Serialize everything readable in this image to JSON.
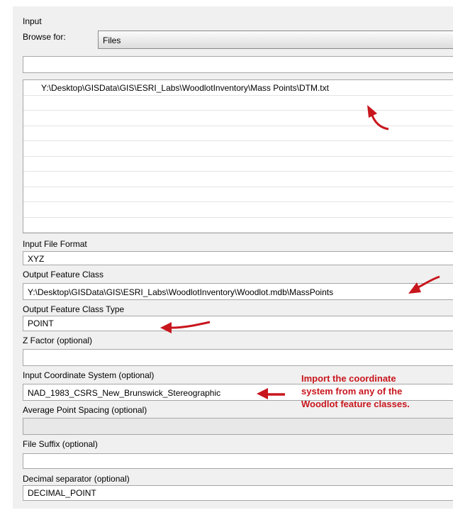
{
  "input_section": {
    "heading": "Input",
    "browse_for_label": "Browse for:",
    "browse_for_value": "Files",
    "path_value": ""
  },
  "file_list": {
    "rows": [
      "Y:\\Desktop\\GISData\\GIS\\ESRI_Labs\\WoodlotInventory\\Mass Points\\DTM.txt",
      "",
      "",
      "",
      "",
      "",
      "",
      "",
      "",
      ""
    ]
  },
  "params": {
    "input_file_format_label": "Input File Format",
    "input_file_format_value": "XYZ",
    "output_feature_class_label": "Output Feature Class",
    "output_feature_class_value": "Y:\\Desktop\\GISData\\GIS\\ESRI_Labs\\WoodlotInventory\\Woodlot.mdb\\MassPoints",
    "output_feature_class_type_label": "Output Feature Class Type",
    "output_feature_class_type_value": "POINT",
    "z_factor_label": "Z Factor (optional)",
    "z_factor_value": "",
    "input_coordinate_system_label": "Input Coordinate System (optional)",
    "input_coordinate_system_value": "NAD_1983_CSRS_New_Brunswick_Stereographic",
    "average_point_spacing_label": "Average Point Spacing (optional)",
    "average_point_spacing_value": "",
    "file_suffix_label": "File Suffix (optional)",
    "file_suffix_value": "",
    "decimal_separator_label": "Decimal separator (optional)",
    "decimal_separator_value": "DECIMAL_POINT"
  },
  "annotation": {
    "note_lines": [
      "Import the coordinate",
      "system from any of the",
      "Woodlot feature classes."
    ],
    "arrow_color": "#c8161d",
    "text_color": "#c8161d"
  },
  "icons": [
    "red-arrow-icon"
  ]
}
